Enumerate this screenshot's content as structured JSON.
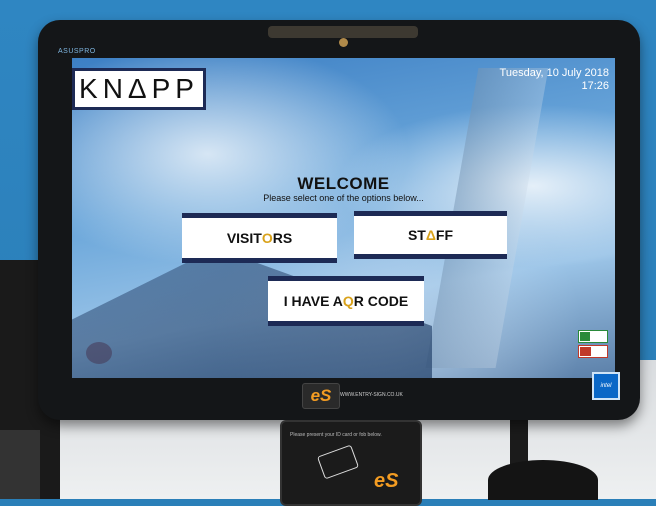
{
  "monitor": {
    "brand": "ASUSPRO"
  },
  "screen": {
    "logo_text": "KNΔPP",
    "date": "Tuesday, 10 July 2018",
    "time": "17:26",
    "welcome_title": "WELCOME",
    "welcome_subtitle": "Please select one of the options below...",
    "buttons": {
      "visitors": {
        "pre": "VISIT",
        "mark": "O",
        "post": "RS"
      },
      "staff": {
        "pre": "ST",
        "mark": "Δ",
        "post": "FF"
      },
      "qr": {
        "pre": "I HAVE A ",
        "mark": "Q",
        "post": "R CODE"
      }
    }
  },
  "footer": {
    "es_logo": "eS",
    "url": "WWW.ENTRY-SIGN.CO.UK",
    "intel_text": "intel"
  },
  "reader": {
    "instruction": "Please present your ID card or fob below.",
    "logo": "eS"
  }
}
